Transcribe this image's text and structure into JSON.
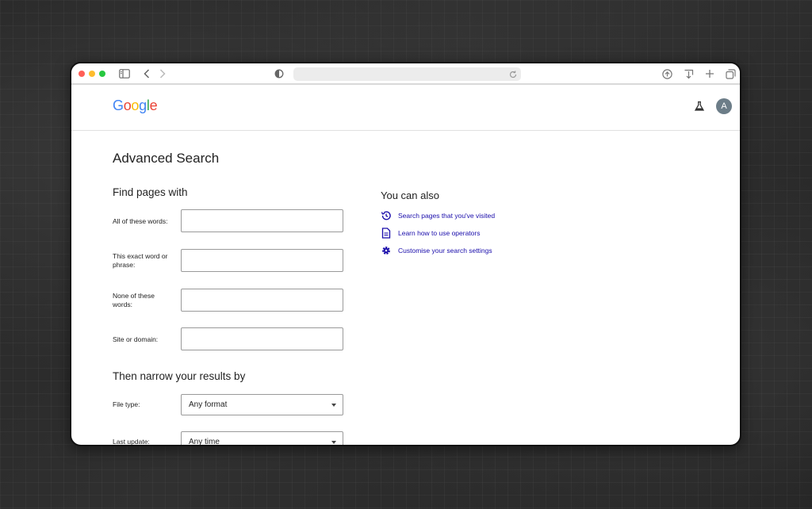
{
  "google": {
    "logo_letters": [
      {
        "ch": "G",
        "color": "#4285F4"
      },
      {
        "ch": "o",
        "color": "#EA4335"
      },
      {
        "ch": "o",
        "color": "#FBBC05"
      },
      {
        "ch": "g",
        "color": "#4285F4"
      },
      {
        "ch": "l",
        "color": "#34A853"
      },
      {
        "ch": "e",
        "color": "#EA4335"
      }
    ],
    "avatar_initial": "A"
  },
  "page": {
    "title": "Advanced Search",
    "find_section": "Find pages with",
    "narrow_section": "Then narrow your results by"
  },
  "find_fields": [
    {
      "label": "All of these words:",
      "value": ""
    },
    {
      "label": "This exact word or phrase:",
      "value": ""
    },
    {
      "label": "None of these words:",
      "value": ""
    },
    {
      "label": "Site or domain:",
      "value": ""
    }
  ],
  "narrow_fields": [
    {
      "label": "File type:",
      "value": "Any format"
    },
    {
      "label": "Last update:",
      "value": "Any time"
    }
  ],
  "also": {
    "title": "You can also",
    "links": [
      {
        "label": "Search pages that you've visited",
        "icon": "history-icon"
      },
      {
        "label": "Learn how to use operators",
        "icon": "document-icon"
      },
      {
        "label": "Customise your search settings",
        "icon": "gear-icon"
      }
    ]
  },
  "colors": {
    "link": "#1a0dab",
    "avatar": "#6c7d88"
  }
}
